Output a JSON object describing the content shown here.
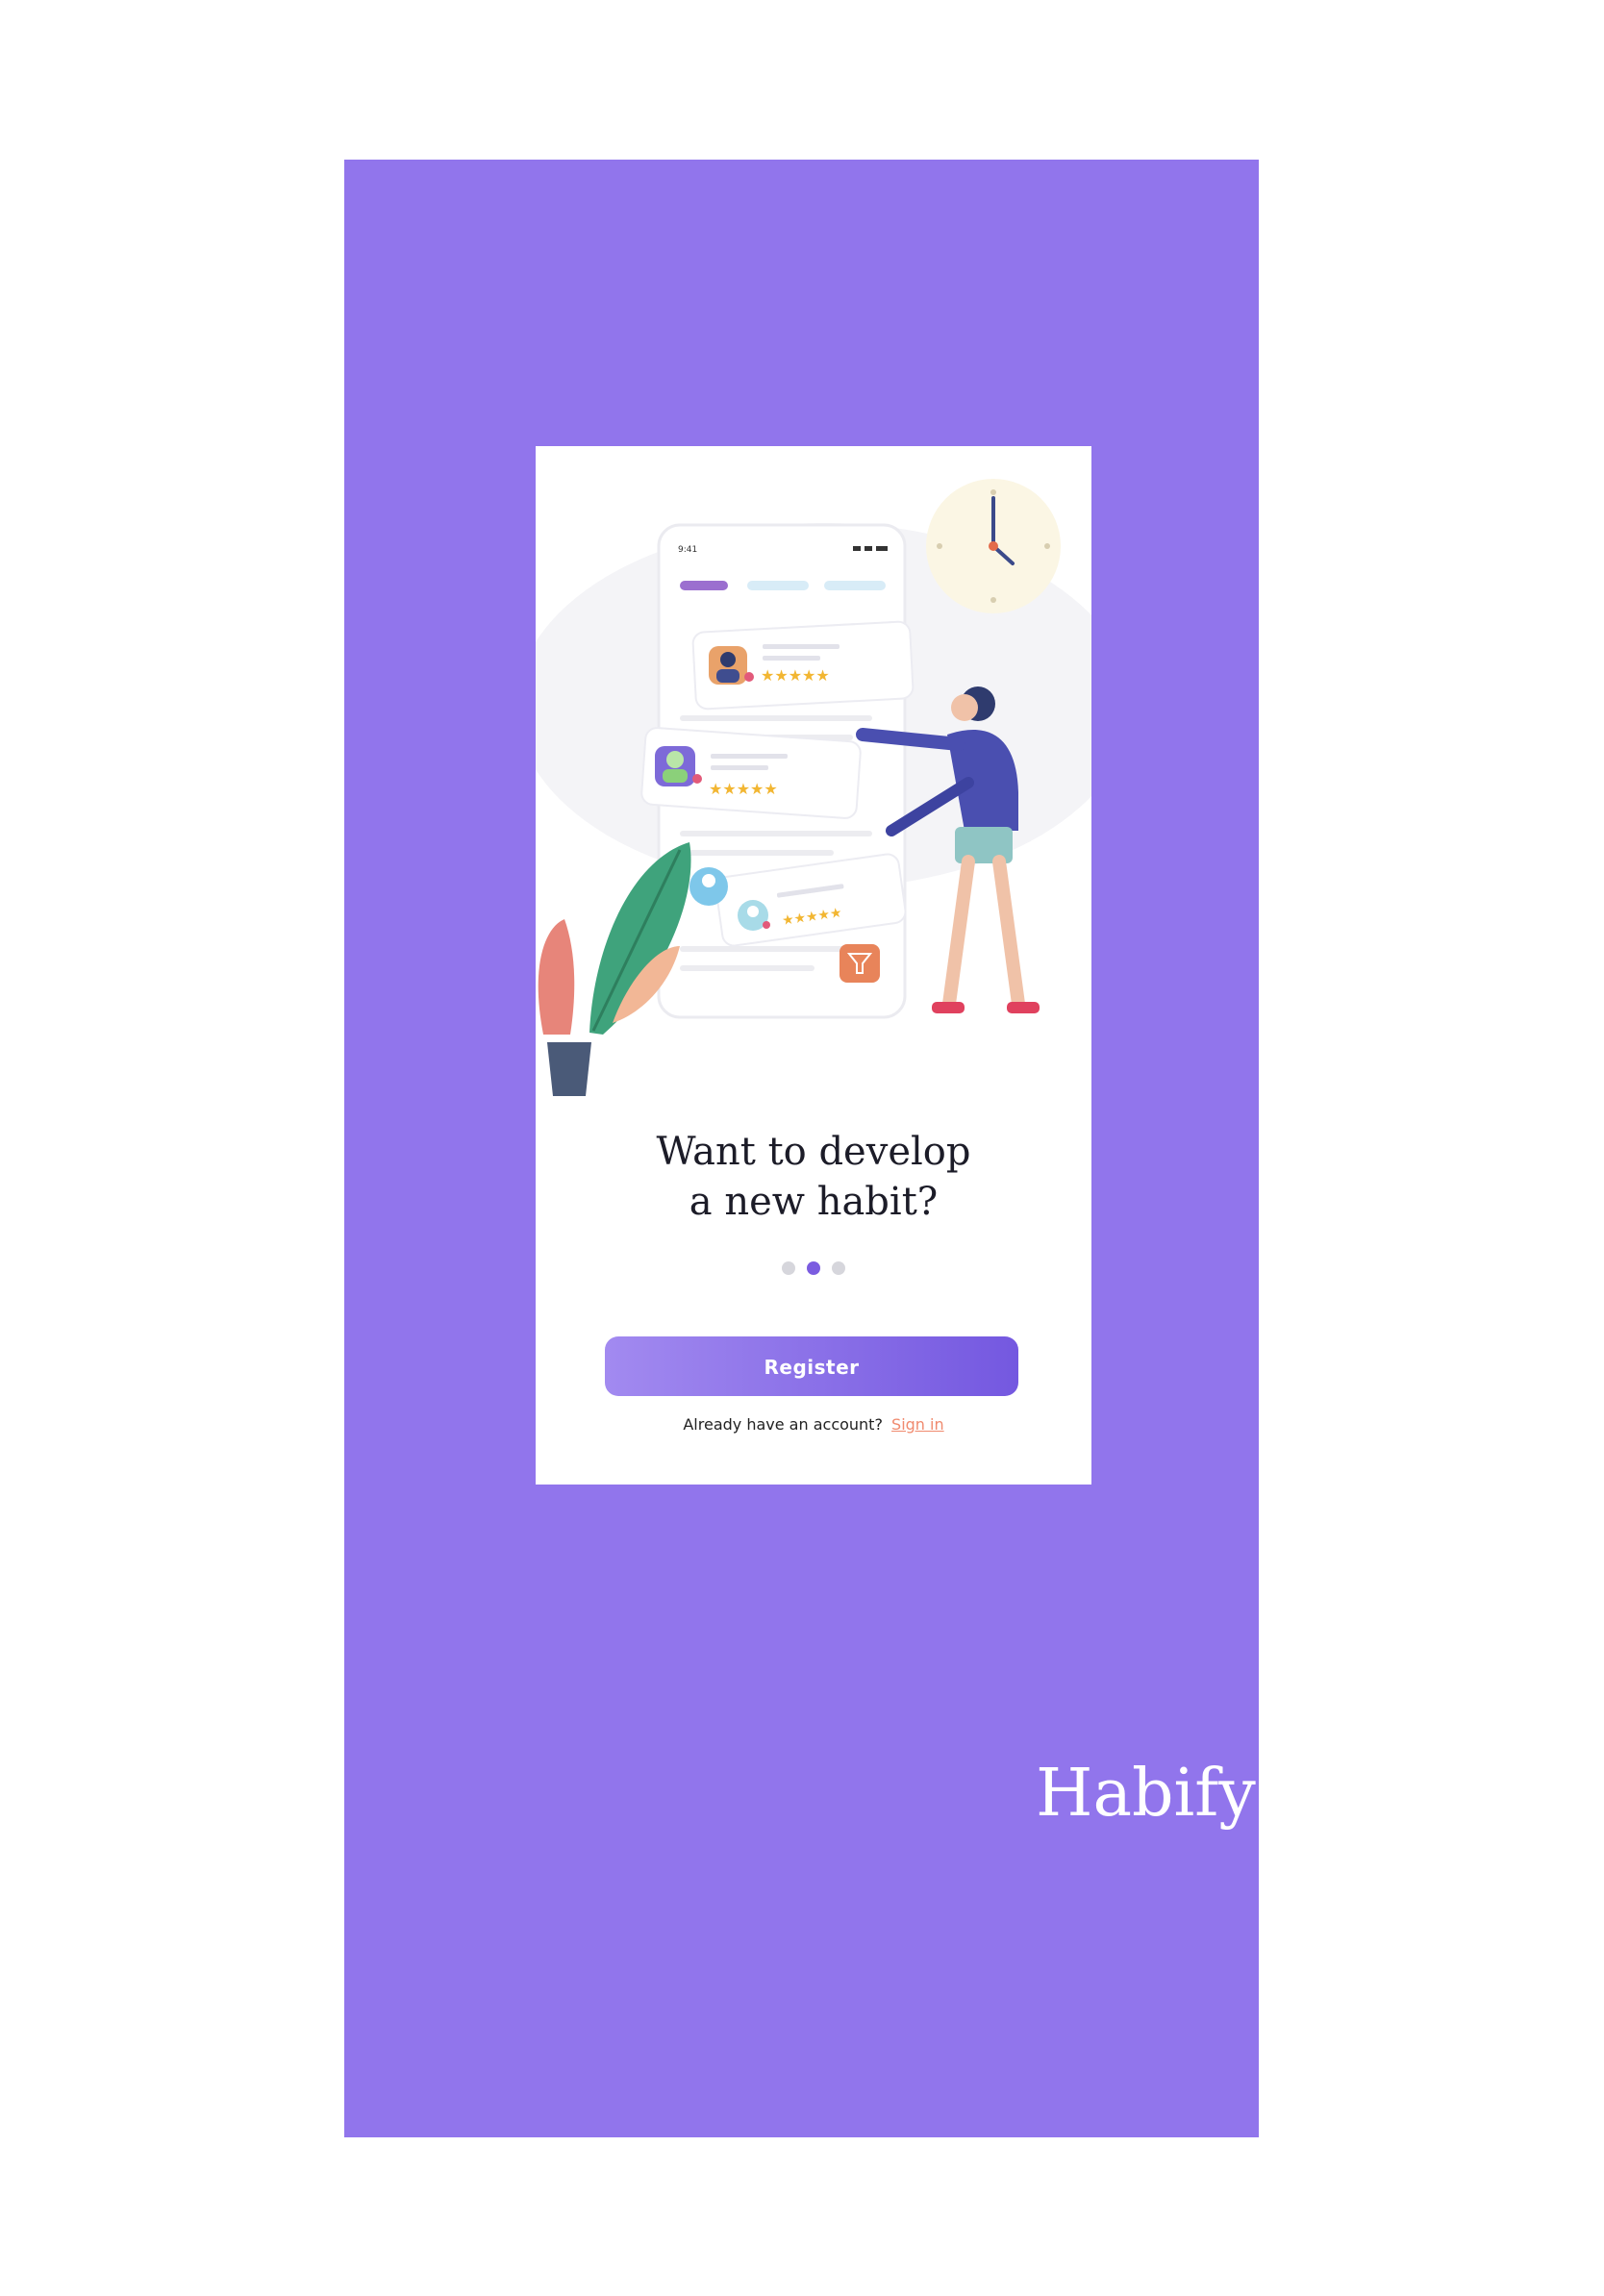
{
  "onboarding": {
    "headline_line1": "Want to develop",
    "headline_line2": "a new habit?",
    "pager": {
      "count": 3,
      "active_index": 1
    },
    "register_label": "Register",
    "signin_prompt": "Already have an account?",
    "signin_label": "Sign in",
    "mini_phone_time": "9:41"
  },
  "brand": {
    "name": "Habify"
  },
  "colors": {
    "panel": "#9175ec",
    "accent": "#7b5ce0",
    "link": "#f08a6e",
    "star": "#f2b632"
  },
  "icons": [
    "clock-icon",
    "avatar-icon",
    "star-icon",
    "filter-icon",
    "plant-icon",
    "person-icon"
  ]
}
